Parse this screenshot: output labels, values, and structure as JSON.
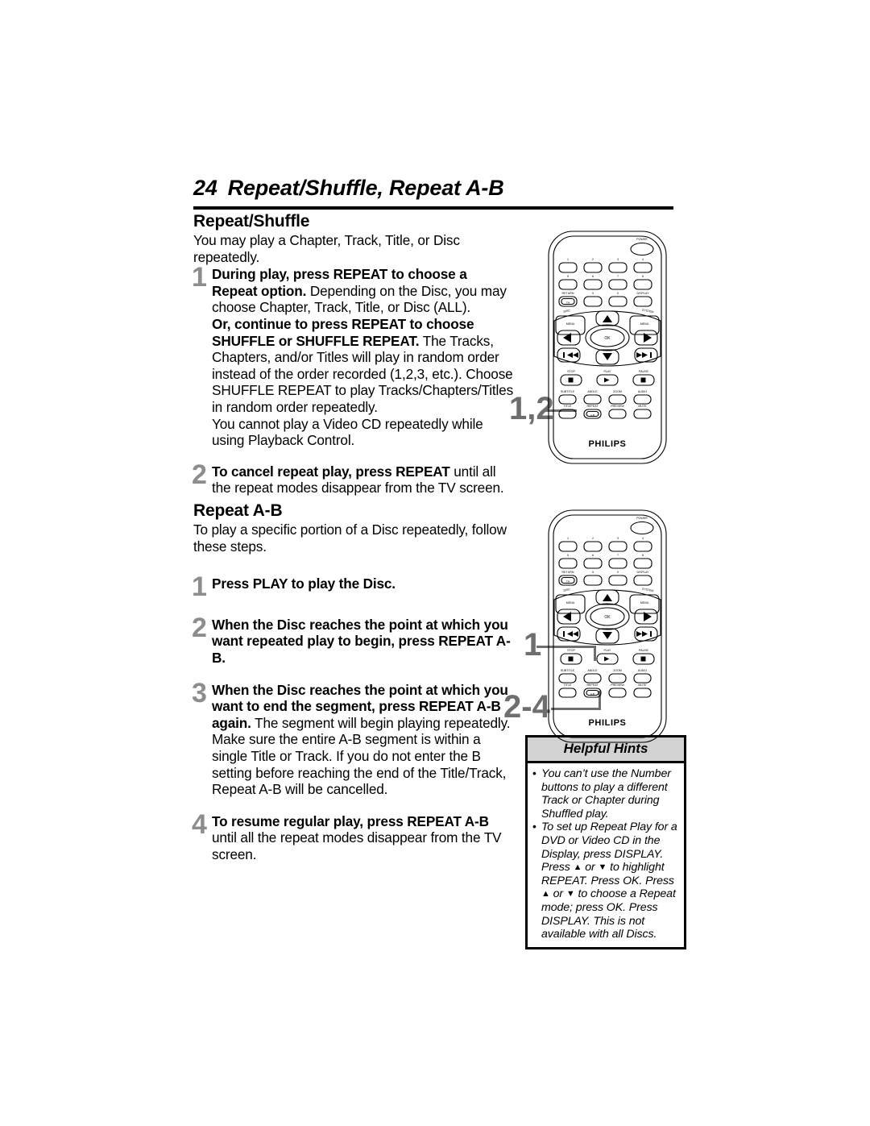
{
  "header": {
    "page_number": "24",
    "title": "Repeat/Shuffle, Repeat A-B"
  },
  "sections": [
    {
      "heading": "Repeat/Shuffle",
      "intro": "You may play a Chapter, Track, Title, or Disc repeatedly.",
      "steps": [
        {
          "num": "1",
          "lines": [
            {
              "bold": "During play, press REPEAT to choose a Repeat option.",
              "rest": " Depending on the Disc, you may choose Chapter, Track, Title, or Disc (ALL)."
            },
            {
              "bold": "Or, continue to press REPEAT to choose SHUFFLE or SHUFFLE REPEAT.",
              "rest": "  The Tracks, Chapters, and/or Titles will play in random order instead of the order recorded (1,2,3, etc.). Choose SHUFFLE REPEAT to play Tracks/Chapters/Titles in random order repeatedly."
            },
            {
              "bold": "",
              "rest": "You cannot play a Video CD repeatedly while using Playback Control."
            }
          ]
        },
        {
          "num": "2",
          "lines": [
            {
              "bold": "To cancel repeat play, press REPEAT",
              "rest": " until all the repeat modes disappear from the TV screen."
            }
          ]
        }
      ]
    },
    {
      "heading": "Repeat A-B",
      "intro": "To play a specific portion of a Disc repeatedly, follow these steps.",
      "steps": [
        {
          "num": "1",
          "lines": [
            {
              "bold": "Press PLAY to play the Disc.",
              "rest": ""
            }
          ]
        },
        {
          "num": "2",
          "lines": [
            {
              "bold": "When the Disc reaches the point at which you want repeated play to begin, press REPEAT A-B.",
              "rest": ""
            }
          ]
        },
        {
          "num": "3",
          "lines": [
            {
              "bold": "When the Disc reaches the point at which you want to end the segment, press REPEAT A-B again.",
              "rest": " The segment will begin playing repeatedly."
            },
            {
              "bold": "",
              "rest": "Make sure the entire A-B segment is within a single Title or Track. If you do not enter the B setting before reaching the end of the Title/Track, Repeat A-B will be cancelled."
            }
          ]
        },
        {
          "num": "4",
          "lines": [
            {
              "bold": "To resume regular play, press REPEAT A-B",
              "rest": " until all the repeat modes disappear from the TV screen."
            }
          ]
        }
      ]
    }
  ],
  "hints": {
    "title": "Helpful Hints",
    "items": [
      "You can’t use the Number buttons to play a different Track or Chapter during Shuffled play.",
      "To set up Repeat Play for a DVD or Video CD in the Display, press DISPLAY. Press ▲ or ▼ to highlight REPEAT. Press OK. Press ▲ or ▼ to choose a Repeat mode; press OK. Press DISPLAY. This is not available with all Discs."
    ]
  },
  "callouts": [
    {
      "label": "1,2",
      "target": "shuffle-button"
    },
    {
      "label": "1",
      "target": "play-button"
    },
    {
      "label": "2-4",
      "target": "repeat-ab-button"
    }
  ],
  "remote": {
    "brand": "PHILIPS",
    "power_label": "POWER",
    "number_keys": [
      "1",
      "2",
      "3",
      "4",
      "5",
      "6",
      "7",
      "8"
    ],
    "row3": [
      "RETURN",
      "9",
      "0",
      "DISPLAY"
    ],
    "return_inner": "TM",
    "disc_menu_top": "DISC",
    "disc_menu": "MENU",
    "system_menu_top": "SYSTEM",
    "system_menu": "MENU",
    "ok_label": "OK",
    "transport": [
      "STOP",
      "PLAY",
      "PAUSE"
    ],
    "func_row1": [
      "SUBTITLE",
      "ANGLE",
      "ZOOM",
      "AUDIO"
    ],
    "func_row2": [
      "TITLE",
      "REPEAT",
      "PREVIEW",
      "MUTE"
    ],
    "repeat_inner": "A-B"
  }
}
